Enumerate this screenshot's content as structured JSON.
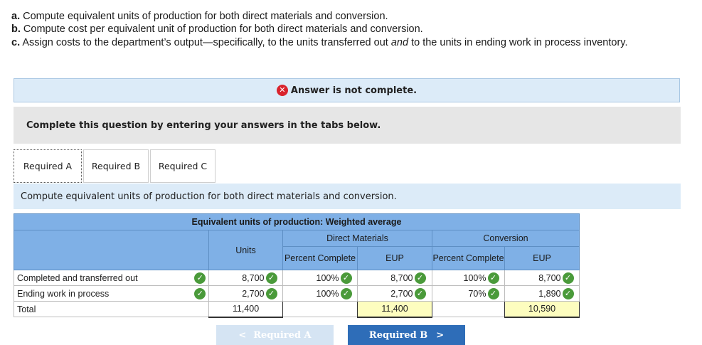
{
  "instructions": [
    {
      "marker": "a.",
      "text": "Compute equivalent units of production for both direct materials and conversion."
    },
    {
      "marker": "b.",
      "text": "Compute cost per equivalent unit of production for both direct materials and conversion."
    },
    {
      "marker": "c.",
      "text_before": "Assign costs to the department’s output—specifically, to the units transferred out ",
      "emph": "and",
      "text_after": " to the units in ending work in process inventory."
    }
  ],
  "status": {
    "icon": "x-icon",
    "text": "Answer is not complete.",
    "color": "#d9232d"
  },
  "prompt": "Complete this question by entering your answers in the tabs below.",
  "tabs": [
    {
      "label": "Required A",
      "active": true
    },
    {
      "label": "Required B",
      "active": false
    },
    {
      "label": "Required C",
      "active": false
    }
  ],
  "subtitle": "Compute equivalent units of production for both direct materials and conversion.",
  "table": {
    "title": "Equivalent units of production: Weighted average",
    "groups": {
      "dm": "Direct Materials",
      "conv": "Conversion"
    },
    "headers": {
      "units": "Units",
      "pct": "Percent Complete",
      "eup": "EUP"
    },
    "rows": [
      {
        "label": "Completed and transferred out",
        "units": "8,700",
        "dm_pct": "100%",
        "dm_eup": "8,700",
        "cv_pct": "100%",
        "cv_eup": "8,700"
      },
      {
        "label": "Ending work in process",
        "units": "2,700",
        "dm_pct": "100%",
        "dm_eup": "2,700",
        "cv_pct": "70%",
        "cv_eup": "1,890"
      }
    ],
    "total": {
      "label": "Total",
      "units": "11,400",
      "dm_eup": "11,400",
      "cv_eup": "10,590"
    }
  },
  "nav": {
    "prev": "Required A",
    "next": "Required B"
  },
  "colors": {
    "header_blue": "#7fb0e6",
    "check_green": "#4a9a3a",
    "highlight_yellow": "#fdfdbf",
    "next_button": "#2e6db8"
  }
}
